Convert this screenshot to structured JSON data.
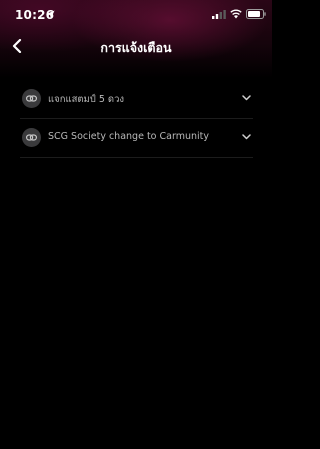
{
  "status_bar": {
    "time": "10:26"
  },
  "header": {
    "title": "การแจ้งเตือน"
  },
  "notifications": [
    {
      "label": "แจกแสตมป์ 5 ดวง",
      "icon": "link-icon"
    },
    {
      "label": "SCG Society change to Carmunity",
      "icon": "link-icon"
    }
  ],
  "colors": {
    "background": "#000000",
    "header_tint": "#2a0616",
    "icon_circle": "#3a3a3c",
    "label_text": "#b8b8b8"
  }
}
